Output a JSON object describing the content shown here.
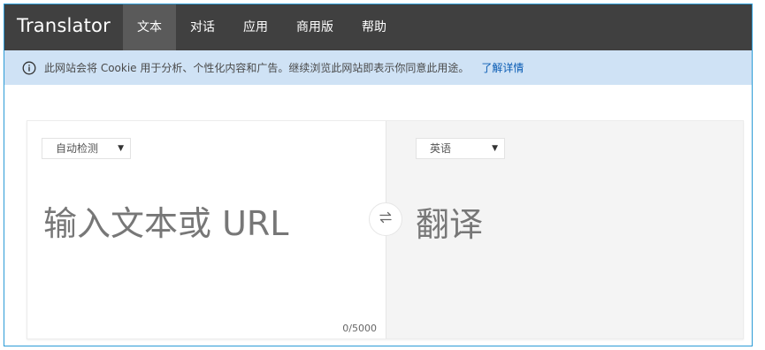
{
  "app": {
    "brand": "Translator"
  },
  "nav": {
    "items": [
      {
        "label": "文本",
        "active": true
      },
      {
        "label": "对话",
        "active": false
      },
      {
        "label": "应用",
        "active": false
      },
      {
        "label": "商用版",
        "active": false
      },
      {
        "label": "帮助",
        "active": false
      }
    ]
  },
  "notice": {
    "icon": "info-icon",
    "text": "此网站会将 Cookie 用于分析、个性化内容和广告。继续浏览此网站即表示你同意此用途。",
    "link_label": "了解详情"
  },
  "source": {
    "language": "自动检测",
    "placeholder": "输入文本或 URL",
    "counter": "0/5000"
  },
  "swap": {
    "icon": "swap-arrows-icon"
  },
  "target": {
    "language": "英语",
    "placeholder": "翻译"
  },
  "colors": {
    "topbar": "#404040",
    "nav_active": "#5a5a5a",
    "notice_bg": "#cfe2f5",
    "link": "#0a5cb4",
    "frame_border": "#2b9bd6"
  }
}
